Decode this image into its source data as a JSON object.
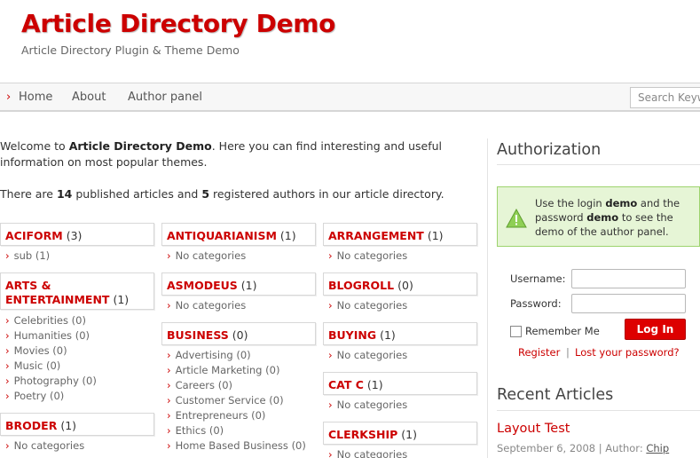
{
  "header": {
    "title": "Article Directory Demo",
    "description": "Article Directory Plugin & Theme Demo"
  },
  "nav": {
    "items": [
      "Home",
      "About",
      "Author panel"
    ],
    "search_placeholder": "Search Keywords"
  },
  "intro": {
    "p1_a": "Welcome to ",
    "p1_b": "Article Directory Demo",
    "p1_c": ". Here you can find interesting and useful information on most popular themes.",
    "p2_a": "There are ",
    "p2_b": "14",
    "p2_c": " published articles and ",
    "p2_d": "5",
    "p2_e": " registered authors in our article directory."
  },
  "categories": {
    "aciform": {
      "name": "ACIFORM",
      "count": "(3)",
      "subs": [
        {
          "name": "sub",
          "count": "(1)"
        }
      ]
    },
    "arts": {
      "name_line1": "ARTS &",
      "name_line2": "ENTERTAINMENT",
      "count": "(1)",
      "subs": [
        {
          "name": "Celebrities",
          "count": "(0)"
        },
        {
          "name": "Humanities",
          "count": "(0)"
        },
        {
          "name": "Movies",
          "count": "(0)"
        },
        {
          "name": "Music",
          "count": "(0)"
        },
        {
          "name": "Photography",
          "count": "(0)"
        },
        {
          "name": "Poetry",
          "count": "(0)"
        }
      ]
    },
    "broder": {
      "name": "BRODER",
      "count": "(1)",
      "subs": [
        {
          "name": "No categories",
          "count": ""
        }
      ]
    },
    "antiquarianism": {
      "name": "ANTIQUARIANISM",
      "count": "(1)",
      "subs": [
        {
          "name": "No categories",
          "count": ""
        }
      ]
    },
    "asmodeus": {
      "name": "ASMODEUS",
      "count": "(1)",
      "subs": [
        {
          "name": "No categories",
          "count": ""
        }
      ]
    },
    "business": {
      "name": "BUSINESS",
      "count": "(0)",
      "subs": [
        {
          "name": "Advertising",
          "count": "(0)"
        },
        {
          "name": "Article Marketing",
          "count": "(0)"
        },
        {
          "name": "Careers",
          "count": "(0)"
        },
        {
          "name": "Customer Service",
          "count": "(0)"
        },
        {
          "name": "Entrepreneurs",
          "count": "(0)"
        },
        {
          "name": "Ethics",
          "count": "(0)"
        },
        {
          "name": "Home Based Business",
          "count": "(0)"
        }
      ]
    },
    "arrangement": {
      "name": "ARRANGEMENT",
      "count": "(1)",
      "subs": [
        {
          "name": "No categories",
          "count": ""
        }
      ]
    },
    "blogroll": {
      "name": "BLOGROLL",
      "count": "(0)",
      "subs": [
        {
          "name": "No categories",
          "count": ""
        }
      ]
    },
    "buying": {
      "name": "BUYING",
      "count": "(1)",
      "subs": [
        {
          "name": "No categories",
          "count": ""
        }
      ]
    },
    "catc": {
      "name": "CAT C",
      "count": "(1)",
      "subs": [
        {
          "name": "No categories",
          "count": ""
        }
      ]
    },
    "clerkship": {
      "name": "CLERKSHIP",
      "count": "(1)",
      "subs": [
        {
          "name": "No categories",
          "count": ""
        }
      ]
    }
  },
  "sidebar": {
    "auth_title": "Authorization",
    "notice": {
      "a": "Use the login ",
      "b": "demo",
      "c": " and the password ",
      "d": "demo",
      "e": " to see the demo of the author panel."
    },
    "username_label": "Username:",
    "password_label": "Password:",
    "remember_label": "Remember Me",
    "login_button": "Log In",
    "register_link": "Register",
    "separator": "|",
    "lost_password_link": "Lost your password?",
    "recent_title": "Recent Articles",
    "recent": [
      {
        "title": "Layout Test",
        "date": "September 6, 2008",
        "author_prefix": " | Author: ",
        "author": "Chip"
      }
    ]
  },
  "colors": {
    "brand_red": "#cc0000",
    "button_red": "#dd0000",
    "notice_bg": "#e6f5d6",
    "notice_border": "#9dd36e",
    "text": "#333333",
    "muted": "#666666"
  },
  "icons": {
    "nav_arrow": "chevron-right-icon",
    "sub_arrow": "chevron-right-icon",
    "notice": "warning-triangle-icon"
  }
}
